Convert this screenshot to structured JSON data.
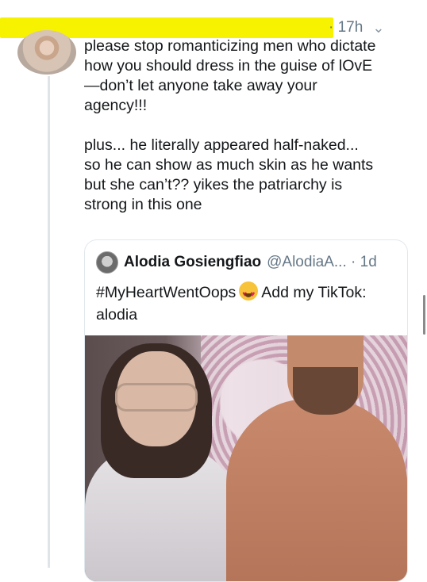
{
  "tweet": {
    "timestamp": "· 17h",
    "menu_icon": "chevron-down-icon",
    "text": "please stop romanticizing men who dictate\nhow you should dress in the guise of lOvE\n—don’t let anyone take away your\nagency!!!\n\nplus... he literally appeared half-naked...\nso he can show as much skin as he wants\nbut she can’t?? yikes the patriarchy is\nstrong in this one"
  },
  "quote": {
    "name": "Alodia Gosiengfiao",
    "handle": "@AlodiaA... · 1d",
    "text_before": "#MyHeartWentOops",
    "emoji": "heart-eyes-emoji",
    "text_after": "Add my TikTok: alodia"
  },
  "colors": {
    "highlight": "#f7f200",
    "muted": "#657786",
    "text": "#14171a",
    "border": "#e1e8ed"
  }
}
